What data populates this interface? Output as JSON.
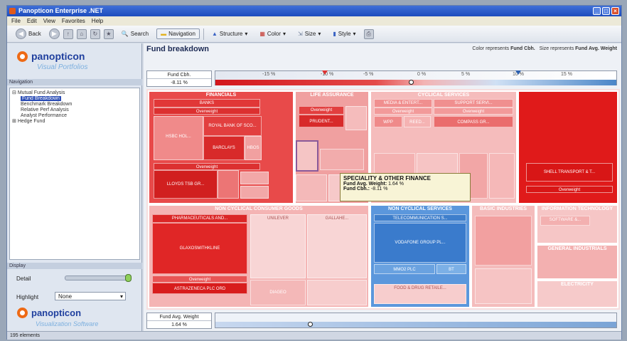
{
  "window": {
    "title": "Panopticon Enterprise .NET"
  },
  "menu": [
    "File",
    "Edit",
    "View",
    "Favorites",
    "Help"
  ],
  "toolbar": {
    "back_label": "Back",
    "search_label": "Search",
    "navigation_label": "Navigation",
    "structure_label": "Structure",
    "color_label": "Color",
    "size_label": "Size",
    "style_label": "Style"
  },
  "left_panel": {
    "logo_text": "panopticon",
    "logo_subtitle": "Visual Portfolios",
    "navigation_header": "Navigation",
    "tree": [
      {
        "label": "Mutual Fund Analysis",
        "level": 0
      },
      {
        "label": "Fund Breakdown",
        "level": 1,
        "selected": true
      },
      {
        "label": "Benchmark Breakdown",
        "level": 1
      },
      {
        "label": "Relative Perf Analysis",
        "level": 1
      },
      {
        "label": "Analyst Performance",
        "level": 1
      },
      {
        "label": "Hedge Fund",
        "level": 0
      }
    ],
    "display_header": "Display",
    "detail_label": "Detail",
    "highlight_label": "Highlight",
    "highlight_value": "None",
    "footer_logo_text": "panopticon",
    "footer_logo_subtitle": "Visualization Software"
  },
  "main": {
    "title": "Fund breakdown",
    "legend_color_prefix": "Color represents",
    "legend_color_value": "Fund Cbh.",
    "legend_size_prefix": "Size represents",
    "legend_size_value": "Fund Avg. Weight",
    "scale1": {
      "label": "Fund Cbh.",
      "value": "-8.11 %",
      "ticks": [
        "-15 %",
        "-10 %",
        "-5 %",
        "0 %",
        "5 %",
        "10 %",
        "15 %"
      ],
      "marker_value": "0"
    },
    "scale2": {
      "label": "Fund Avg. Weight",
      "value": "1.64 %",
      "marker_value": "0"
    }
  },
  "treemap": {
    "sectors": [
      {
        "name": "FINANCIALS",
        "color": "#e23b3b"
      },
      {
        "name": "LIFE ASSURANCE",
        "color": "#ea6a6a"
      },
      {
        "name": "CYCLICAL SERVICES",
        "color": "#f2a2a2"
      },
      {
        "name": "NON CYCLICAL CONSUMER GOODS",
        "color": "#ea6a6a"
      },
      {
        "name": "NON CYCLICAL SERVICES",
        "color": "#4f8fd6"
      },
      {
        "name": "BASIC INDUSTRIES",
        "color": "#f2b3b3"
      },
      {
        "name": "INFORMATION TECHNOLOGY",
        "color": "#f6c6c6"
      },
      {
        "name": "GENERAL INDUSTRIALS",
        "color": "#f3b0b0"
      }
    ],
    "cells": {
      "banks": "BANKS",
      "hsbc": "HSBC HOL...",
      "rbs": "ROYAL BANK OF SCO...",
      "barclays": "BARCLAYS",
      "hbos": "HBOS",
      "lloyds": "LLOYDS TSB GR...",
      "media": "MEDIA & ENTERT...",
      "support": "SUPPORT SERVI...",
      "prudential": "PRUDENT...",
      "wpp": "WPP",
      "reed": "REED...",
      "compass": "COMPASS GR...",
      "transport": "SHELL TRANSPORT & T...",
      "pharma": "PHARMACEUTICALS AND...",
      "astrazeneca": "ASTRAZENECA PLC ORD",
      "glaxo": "GLAXOSMITHKLINE",
      "unilever": "UNILEVER",
      "gallaher": "GALLAHE...",
      "diageo": "DIAGEO",
      "vodafone": "VODAFONE GROUP PL...",
      "mmo2": "MMO2 PLC",
      "bt": "BT",
      "telecom": "TELECOMMUNICATION S...",
      "food_drug": "FOOD & DRUG RETAILE...",
      "electricity": "ELECTRICITY",
      "software": "SOFTWARE &...",
      "overweight": "Overweight"
    }
  },
  "tooltip": {
    "title": "SPECIALITY & OTHER FINANCE",
    "row1_label": "Fund Avg. Weight:",
    "row1_value": "1.64 %",
    "row2_label": "Fund Cbh.:",
    "row2_value": "-8.11 %"
  },
  "status": {
    "text": "195 elements"
  }
}
